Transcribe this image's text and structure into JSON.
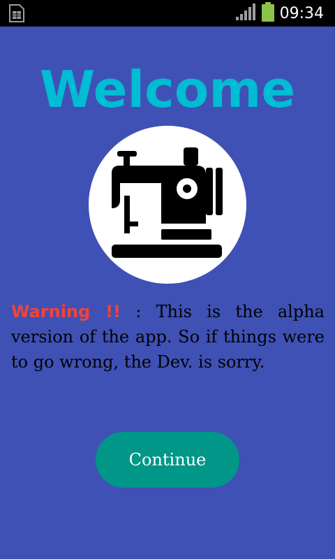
{
  "status_bar": {
    "time": "09:34",
    "icons": [
      "sim-card-icon",
      "signal-bars-icon",
      "battery-charging-icon"
    ]
  },
  "screen": {
    "title": "Welcome",
    "logo_icon": "sewing-machine-icon",
    "warning": {
      "label": "Warning !!",
      "message": " : This is the alpha version of the app. So if things were to go wrong, the Dev. is sorry."
    },
    "continue_label": "Continue"
  },
  "colors": {
    "background": "#3f51b5",
    "title": "#00bcd4",
    "warning_label": "#f44336",
    "button": "#009688",
    "battery": "#8bc34a"
  }
}
